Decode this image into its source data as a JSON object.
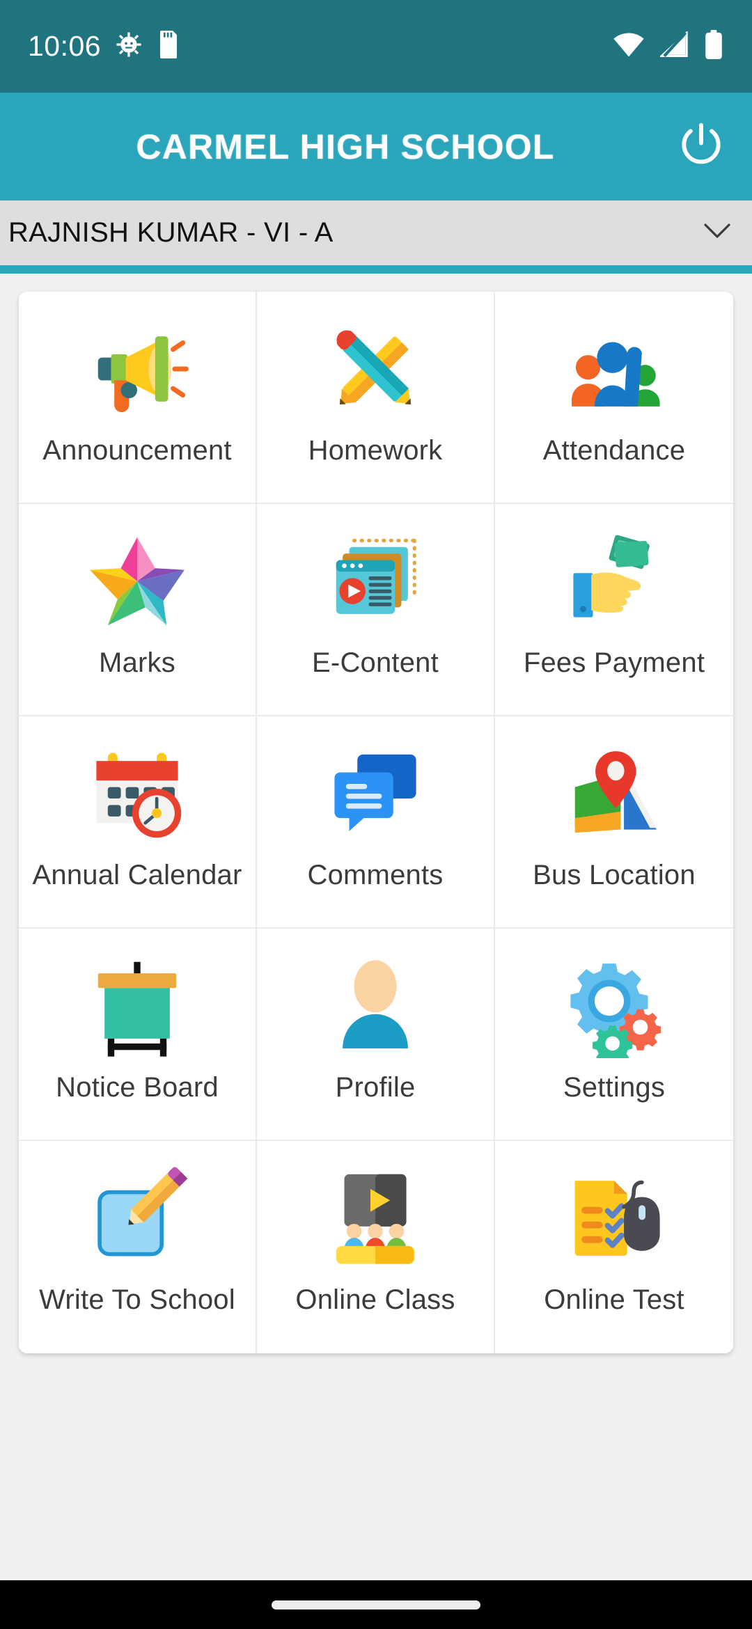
{
  "status_bar": {
    "time": "10:06",
    "icons_left": [
      "android-debug-icon",
      "sd-card-icon"
    ],
    "icons_right": [
      "wifi-icon",
      "signal-none-icon",
      "battery-full-icon"
    ]
  },
  "app_bar": {
    "title": "CARMEL HIGH SCHOOL",
    "logout_icon": "power-icon",
    "background_color": "#2ba5bb"
  },
  "selector": {
    "value": "RAJNISH KUMAR - VI - A",
    "chevron_icon": "chevron-down-icon",
    "background_color": "#dedede"
  },
  "theme": {
    "accent": "#2ba5bb",
    "status_bar": "#1f7480",
    "page_background": "#f0f0f0",
    "tile_background": "#ffffff",
    "label_color": "#3b3b3b"
  },
  "menu": {
    "tiles": [
      {
        "label": "Announcement",
        "icon": "megaphone-icon"
      },
      {
        "label": "Homework",
        "icon": "crossed-pencils-icon"
      },
      {
        "label": "Attendance",
        "icon": "people-raised-hand-icon"
      },
      {
        "label": "Marks",
        "icon": "colorful-star-icon"
      },
      {
        "label": "E-Content",
        "icon": "stacked-media-windows-icon"
      },
      {
        "label": "Fees Payment",
        "icon": "hand-with-money-icon"
      },
      {
        "label": "Annual Calendar",
        "icon": "calendar-clock-icon"
      },
      {
        "label": "Comments",
        "icon": "chat-bubbles-icon"
      },
      {
        "label": "Bus Location",
        "icon": "map-pin-icon"
      },
      {
        "label": "Notice Board",
        "icon": "notice-board-icon"
      },
      {
        "label": "Profile",
        "icon": "user-avatar-icon"
      },
      {
        "label": "Settings",
        "icon": "gears-icon"
      },
      {
        "label": "Write To School",
        "icon": "pencil-note-icon"
      },
      {
        "label": "Online Class",
        "icon": "classroom-screen-icon"
      },
      {
        "label": "Online Test",
        "icon": "checklist-mouse-icon"
      }
    ]
  },
  "navigation_bar": {
    "home_indicator": "home-pill"
  }
}
